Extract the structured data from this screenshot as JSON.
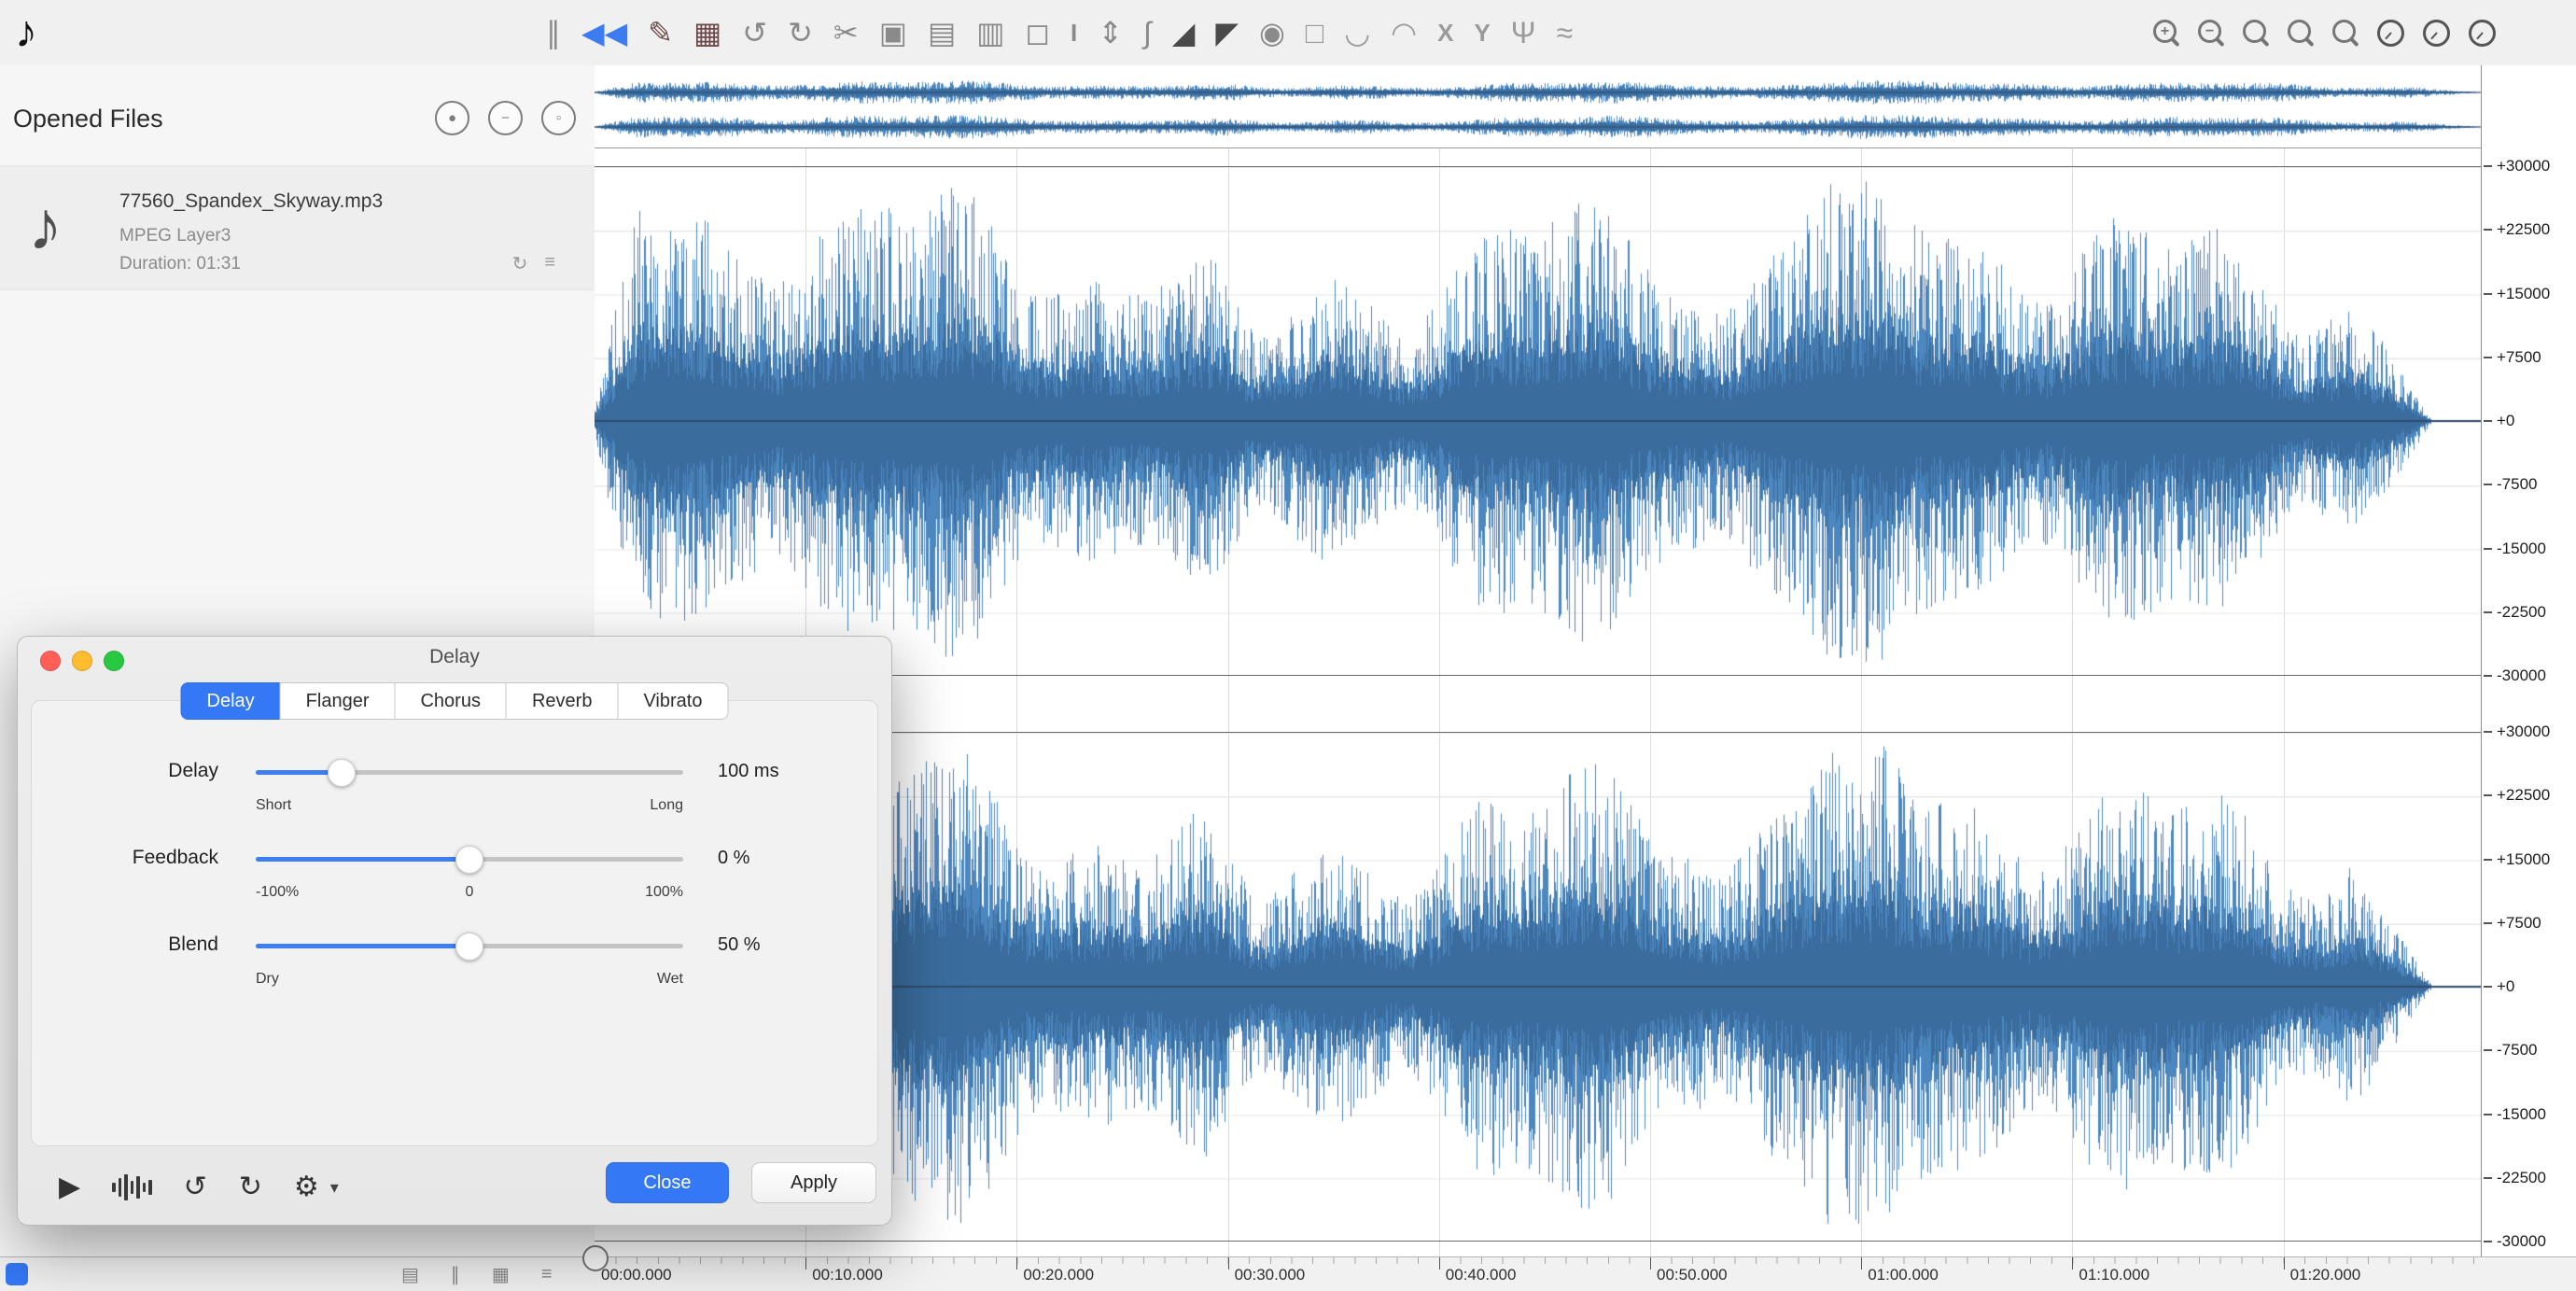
{
  "app": {
    "accent": "#3478f6",
    "waveform_color": "#4d87c0",
    "waveform_core_color": "#3a6d9e",
    "waveform_axis_color": "#2e4d6b",
    "logo_glyph": "♪"
  },
  "toolbar": {
    "icons": [
      {
        "name": "pause-icon",
        "glyph": "∥",
        "color": "#8a8a8a"
      },
      {
        "name": "skip-back-icon",
        "glyph": "◀◀",
        "color": "#3b7df0",
        "active": true
      },
      {
        "name": "record-edit-icon",
        "glyph": "✎",
        "color": "#6d4848"
      },
      {
        "name": "record-mix-icon",
        "glyph": "▦",
        "color": "#6d4848"
      },
      {
        "name": "undo-icon",
        "glyph": "↺",
        "color": "#8a8a8a"
      },
      {
        "name": "redo-icon",
        "glyph": "↻",
        "color": "#8a8a8a"
      },
      {
        "name": "cut-icon",
        "glyph": "✂",
        "color": "#8a8a8a"
      },
      {
        "name": "copy-icon",
        "glyph": "▣",
        "color": "#8a8a8a"
      },
      {
        "name": "paste-icon",
        "glyph": "▤",
        "color": "#8a8a8a"
      },
      {
        "name": "clipboard-icon",
        "glyph": "▥",
        "color": "#8a8a8a"
      },
      {
        "name": "trim-icon",
        "glyph": "◻",
        "color": "#8a8a8a"
      },
      {
        "name": "ibeam-tool-icon",
        "glyph": "I",
        "color": "#8a8a8a",
        "small": true
      },
      {
        "name": "vertical-zoom-icon",
        "glyph": "⇕",
        "color": "#8a8a8a"
      },
      {
        "name": "pen-curve-icon",
        "glyph": "∫",
        "color": "#8a8a8a"
      },
      {
        "name": "fade-in-icon",
        "glyph": "◢",
        "color": "#4a4a4a"
      },
      {
        "name": "fade-out-icon",
        "glyph": "◤",
        "color": "#4a4a4a"
      },
      {
        "name": "meter-icon",
        "glyph": "◉",
        "color": "#8a8a8a"
      },
      {
        "name": "frame-icon",
        "glyph": "□",
        "color": "#9a9a9a"
      },
      {
        "name": "arc-down-icon",
        "glyph": "◡",
        "color": "#9a9a9a"
      },
      {
        "name": "arc-up-icon",
        "glyph": "◠",
        "color": "#9a9a9a"
      },
      {
        "name": "x-tool-icon",
        "glyph": "X",
        "color": "#9a9a9a",
        "small": true
      },
      {
        "name": "y-tool-icon",
        "glyph": "Y",
        "color": "#9a9a9a",
        "small": true
      },
      {
        "name": "split-tool-icon",
        "glyph": "Ψ",
        "color": "#9a9a9a"
      },
      {
        "name": "wave-tool-icon",
        "glyph": "≈",
        "color": "#9a9a9a"
      }
    ],
    "zoom_icons": [
      {
        "name": "zoom-in-icon",
        "sign": "+"
      },
      {
        "name": "zoom-out-icon",
        "sign": "−"
      },
      {
        "name": "zoom-selection-icon",
        "sign": ""
      },
      {
        "name": "zoom-fit-icon",
        "sign": ""
      },
      {
        "name": "zoom-vertical-icon",
        "sign": ""
      }
    ],
    "knob_icons": [
      "meter-knob-icon-1",
      "meter-knob-icon-2",
      "meter-knob-icon-3"
    ]
  },
  "sidebar": {
    "title": "Opened Files",
    "header_icons": [
      {
        "name": "record-file-icon",
        "glyph": "●"
      },
      {
        "name": "remove-file-icon",
        "glyph": "−"
      },
      {
        "name": "duplicate-file-icon",
        "glyph": "▫"
      }
    ],
    "file": {
      "icon_glyph": "♪",
      "name": "77560_Spandex_Skyway.mp3",
      "format": "MPEG Layer3",
      "duration": "Duration: 01:31",
      "mini_icons": [
        {
          "name": "loop-mini-icon",
          "glyph": "↻"
        },
        {
          "name": "levels-mini-icon",
          "glyph": "≡"
        }
      ]
    }
  },
  "waveform": {
    "channels": 2,
    "end_fraction": 0.974,
    "scale_labels": [
      "+30000",
      "+22500",
      "+15000",
      "+7500",
      "+0",
      "-7500",
      "-15000",
      "-22500",
      "-30000"
    ]
  },
  "timeline": {
    "labels": [
      "00:00.000",
      "00:10.000",
      "00:20.000",
      "00:30.000",
      "00:40.000",
      "00:50.000",
      "01:00.000",
      "01:10.000",
      "01:20.000"
    ]
  },
  "statusbar": {
    "icons": [
      {
        "name": "keyboard-icon",
        "glyph": "▤"
      },
      {
        "name": "pause-small-icon",
        "glyph": "∥"
      },
      {
        "name": "grid-small-icon",
        "glyph": "▦"
      },
      {
        "name": "meter-small-icon",
        "glyph": "≡"
      }
    ]
  },
  "dialog": {
    "title": "Delay",
    "traffic_lights": [
      "#ff5f57",
      "#febc2e",
      "#28c840"
    ],
    "tabs": [
      {
        "label": "Delay",
        "active": true
      },
      {
        "label": "Flanger",
        "active": false
      },
      {
        "label": "Chorus",
        "active": false
      },
      {
        "label": "Reverb",
        "active": false
      },
      {
        "label": "Vibrato",
        "active": false
      }
    ],
    "rows": [
      {
        "label": "Delay",
        "value": "100 ms",
        "pos": 0.2,
        "sub": [
          {
            "t": "Short",
            "a": "l"
          },
          {
            "t": "Long",
            "a": "r"
          }
        ]
      },
      {
        "label": "Feedback",
        "value": "0 %",
        "pos": 0.5,
        "sub": [
          {
            "t": "-100%",
            "a": "l"
          },
          {
            "t": "0",
            "a": "c"
          },
          {
            "t": "100%",
            "a": "r"
          }
        ]
      },
      {
        "label": "Blend",
        "value": "50 %",
        "pos": 0.5,
        "sub": [
          {
            "t": "Dry",
            "a": "l"
          },
          {
            "t": "Wet",
            "a": "r"
          }
        ]
      }
    ],
    "footer_icons": [
      {
        "name": "preview-play-icon",
        "glyph": "▶"
      },
      {
        "name": "preview-wave-icon",
        "glyph": "bars"
      },
      {
        "name": "loop-back-icon",
        "glyph": "↺"
      },
      {
        "name": "loop-icon",
        "glyph": "↻"
      },
      {
        "name": "settings-gear-icon",
        "glyph": "⚙"
      },
      {
        "name": "gear-dropdown-icon",
        "glyph": "▾",
        "chev": true
      }
    ],
    "buttons": {
      "close": "Close",
      "apply": "Apply"
    }
  }
}
